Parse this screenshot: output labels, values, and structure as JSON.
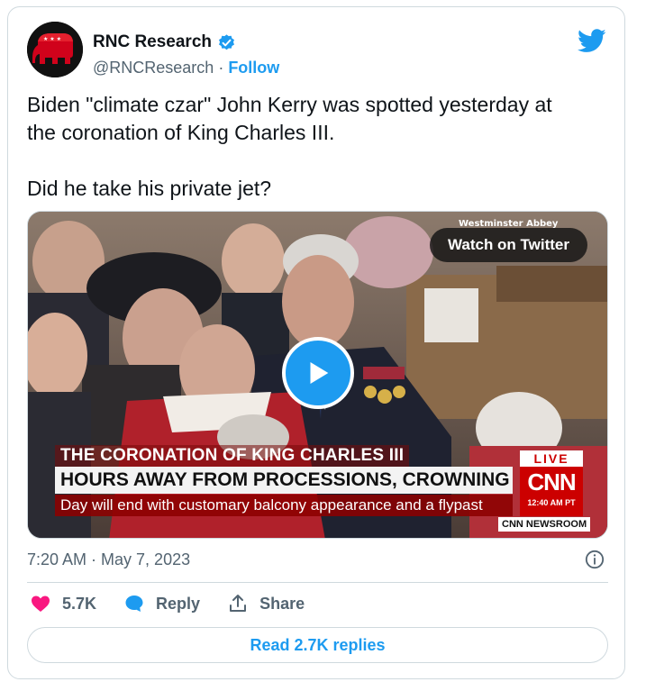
{
  "account": {
    "name": "RNC Research",
    "handle": "@RNCResearch",
    "separator": "·",
    "follow_label": "Follow"
  },
  "tweet": {
    "text": "Biden \"climate czar\" John Kerry was spotted yesterday at\nthe coronation of King Charles III.\n\nDid he take his private jet?",
    "timestamp": "7:20 AM · May 7, 2023"
  },
  "media": {
    "watch_label": "Watch on Twitter",
    "chyron": {
      "title": "THE CORONATION OF KING CHARLES III",
      "headline": "HOURS AWAY FROM PROCESSIONS, CROWNING CEREMONY",
      "subline": "Day will end with customary balcony appearance and a flypast",
      "live": "LIVE",
      "network": "CNN",
      "time": "12:40 AM PT",
      "show": "CNN NEWSROOM",
      "location": "Westminster Abbey"
    }
  },
  "actions": {
    "like_count": "5.7K",
    "reply_label": "Reply",
    "share_label": "Share",
    "read_replies_label": "Read 2.7K replies"
  },
  "colors": {
    "brand_blue": "#1d9bf0",
    "like_pink": "#f91880",
    "cnn_red": "#cc0000",
    "rnc_red": "#d0021b"
  },
  "icons": [
    "verified-badge-icon",
    "twitter-bird-icon",
    "play-icon",
    "info-icon",
    "heart-icon",
    "reply-bubble-icon",
    "share-icon",
    "rnc-elephant-icon"
  ]
}
